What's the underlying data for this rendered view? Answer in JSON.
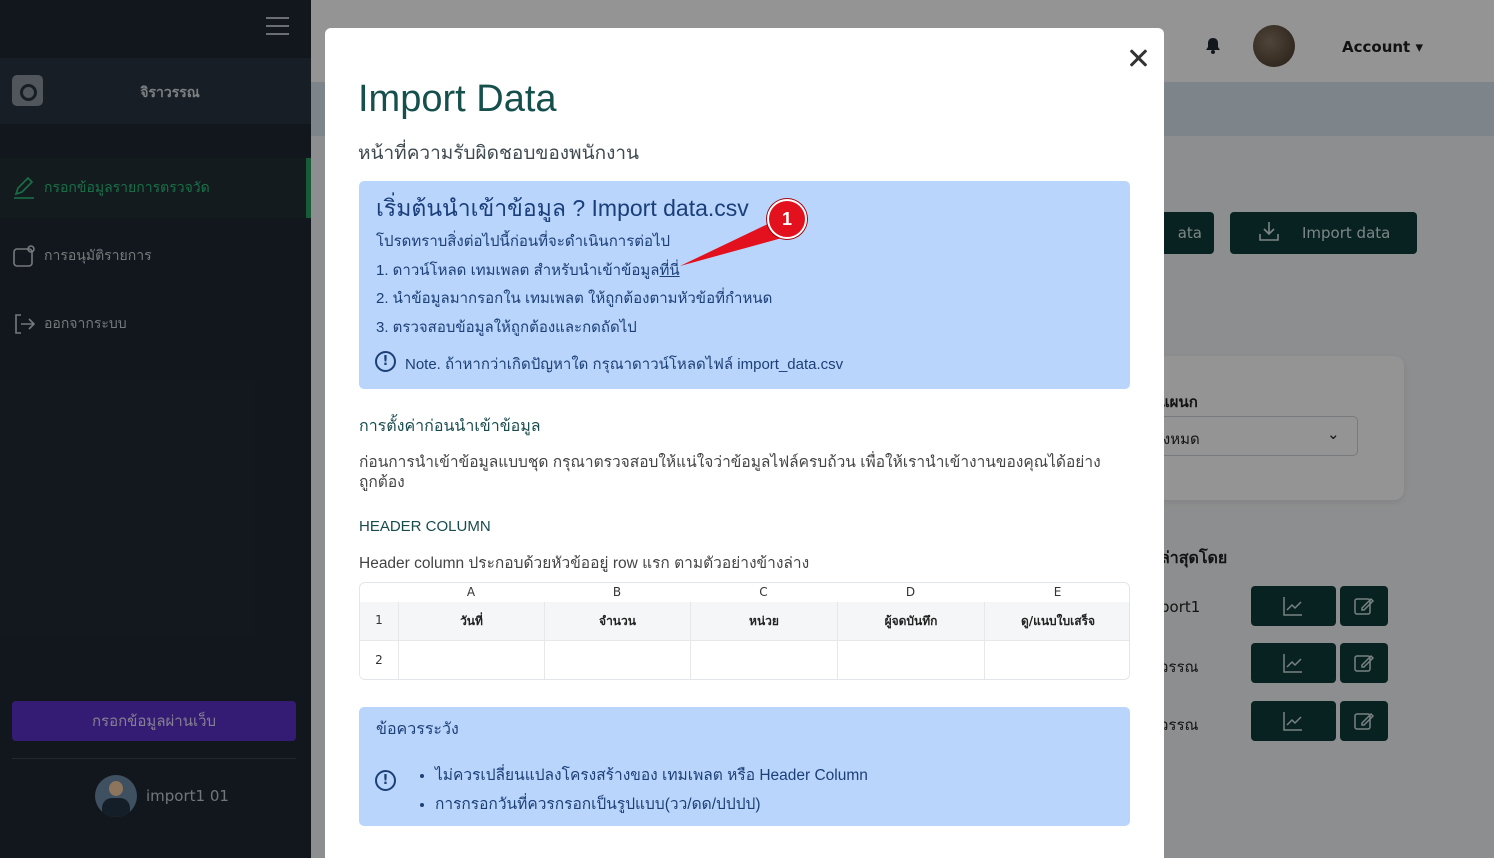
{
  "sidebar": {
    "brand_name": "จิราวรรณ",
    "items": [
      {
        "label": "กรอกข้อมูลรายการตรวจวัด",
        "active": true
      },
      {
        "label": "การอนุมัติรายการ",
        "active": false
      },
      {
        "label": "ออกจากระบบ",
        "active": false
      }
    ],
    "web_entry_label": "กรอกข้อมูลผ่านเว็บ",
    "user_name": "import1 01"
  },
  "topbar": {
    "account_label": "Account"
  },
  "background": {
    "btn_partial_label": "ata",
    "import_button_label": "Import data",
    "field_label_partial": "แผนก",
    "select_partial_value": "ทั้งหมด",
    "recent_heading_partial": "ล่าสุดโดย",
    "rows": [
      "port1",
      "วรรณ",
      "วรรณ"
    ]
  },
  "modal": {
    "title": "Import Data",
    "subtitle": "หน้าที่ความรับผิดชอบของพนักงาน",
    "info": {
      "title": "เริ่มต้นนำเข้าข้อมูล ? Import data.csv",
      "intro": "โปรดทราบสิ่งต่อไปนี้ก่อนที่จะดำเนินการต่อไป",
      "step1": "1. ดาวน์โหลด เทมเพลต สำหรับนำเข้าข้อมูล",
      "step1_link": "ที่นี่",
      "step2": "2. นำข้อมูลมากรอกใน เทมเพลต ให้ถูกต้องตามหัวข้อที่กำหนด",
      "step3": "3. ตรวจสอบข้อมูลให้ถูกต้องและกดถัดไป",
      "note": "Note. ถ้าหากว่าเกิดปัญหาใด กรุณาดาวน์โหลดไฟล์ import_data.csv"
    },
    "settings_heading": "การตั้งค่าก่อนนำเข้าข้อมูล",
    "settings_text": "ก่อนการนำเข้าข้อมูลแบบชุด กรุณาตรวจสอบให้แน่ใจว่าข้อมูลไฟล์ครบถ้วน เพื่อให้เรานำเข้างานของคุณได้อย่างถูกต้อง",
    "header_column_heading": "HEADER COLUMN",
    "header_column_text": "Header column ประกอบด้วยหัวข้ออยู่ row แรก ตามตัวอย่างข้างล่าง",
    "sheet": {
      "columns": [
        "A",
        "B",
        "C",
        "D",
        "E"
      ],
      "row_numbers": [
        "1",
        "2"
      ],
      "headers": [
        "วันที่",
        "จำนวน",
        "หน่วย",
        "ผู้จดบันทึก",
        "ดู/แนบใบเสร็จ"
      ]
    },
    "warning": {
      "title": "ข้อควรระวัง",
      "items": [
        "ไม่ควรเปลี่ยนแปลงโครงสร้างของ เทมเพลต หรือ Header Column",
        "การกรอกวันที่ควรกรอกเป็นรูปแบบ(วว/ดด/ปปปป)"
      ]
    }
  },
  "annotation": {
    "badge_number": "1"
  },
  "colors": {
    "sidebar_bg": "#1f2933",
    "accent_green": "#2bc17a",
    "web_entry_purple": "#5b2fc6",
    "modal_title": "#16504d",
    "info_box_bg": "#b9d5fb",
    "info_text": "#1c3f78",
    "dark_teal_button": "#0e3b3b",
    "annotation_red": "#e3101d"
  },
  "icons": [
    "menu-icon",
    "camera-icon",
    "pencil-icon",
    "approval-icon",
    "logout-icon",
    "bell-icon",
    "download-icon",
    "chevron-down-icon",
    "chart-icon",
    "edit-icon",
    "close-icon",
    "info-icon"
  ]
}
